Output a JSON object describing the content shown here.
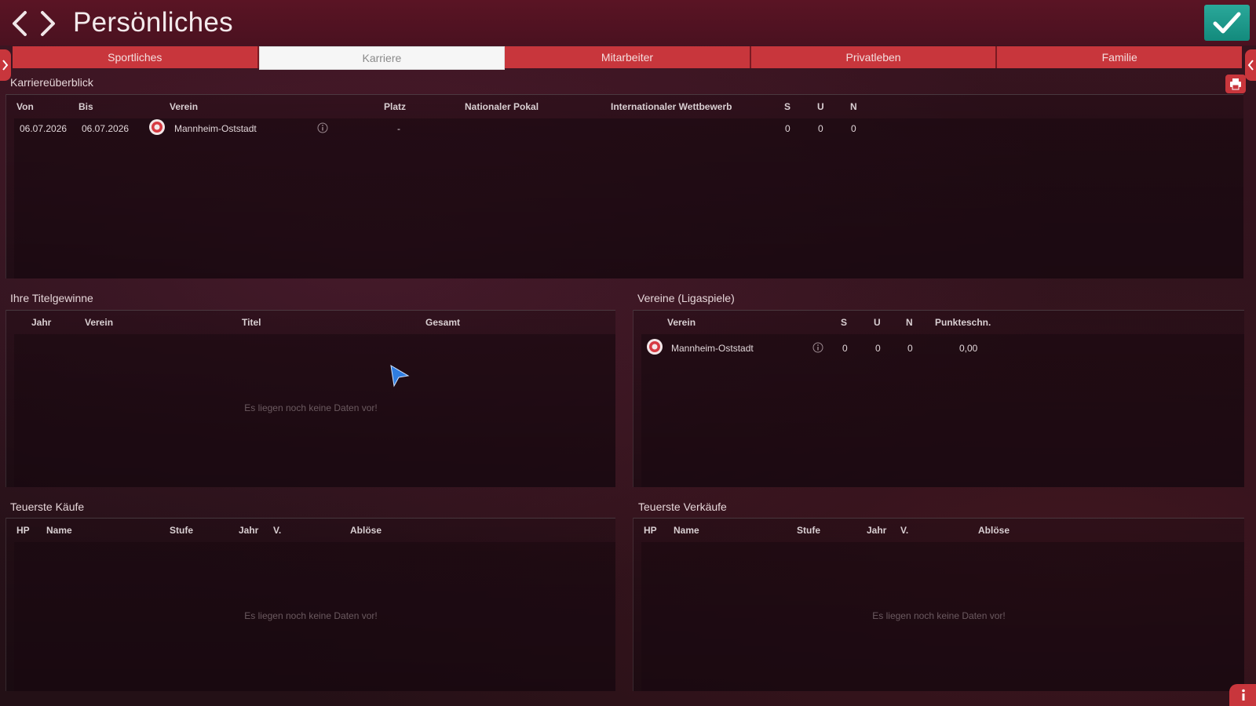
{
  "header": {
    "title": "Persönliches",
    "back_icon": "chevron-left-icon",
    "forward_icon": "chevron-right-icon",
    "confirm_icon": "checkmark-icon"
  },
  "tabs": [
    {
      "label": "Sportliches",
      "active": false
    },
    {
      "label": "Karriere",
      "active": true
    },
    {
      "label": "Mitarbeiter",
      "active": false
    },
    {
      "label": "Privatleben",
      "active": false
    },
    {
      "label": "Familie",
      "active": false
    }
  ],
  "career": {
    "title": "Karriereüberblick",
    "columns": {
      "von": "Von",
      "bis": "Bis",
      "verein": "Verein",
      "platz": "Platz",
      "pokal": "Nationaler Pokal",
      "intl": "Internationaler Wettbewerb",
      "s": "S",
      "u": "U",
      "n": "N"
    },
    "rows": [
      {
        "von": "06.07.2026",
        "bis": "06.07.2026",
        "verein": "Mannheim-Oststadt",
        "platz": "-",
        "pokal": "",
        "intl": "",
        "s": "0",
        "u": "0",
        "n": "0"
      }
    ]
  },
  "titles": {
    "title": "Ihre Titelgewinne",
    "columns": {
      "jahr": "Jahr",
      "verein": "Verein",
      "titel": "Titel",
      "gesamt": "Gesamt"
    },
    "empty": "Es liegen noch keine Daten vor!"
  },
  "clubs": {
    "title": "Vereine (Ligaspiele)",
    "columns": {
      "verein": "Verein",
      "s": "S",
      "u": "U",
      "n": "N",
      "punkte": "Punkteschn."
    },
    "rows": [
      {
        "verein": "Mannheim-Oststadt",
        "s": "0",
        "u": "0",
        "n": "0",
        "punkte": "0,00"
      }
    ]
  },
  "purchases": {
    "title": "Teuerste Käufe",
    "columns": {
      "hp": "HP",
      "name": "Name",
      "stufe": "Stufe",
      "jahr": "Jahr",
      "v": "V.",
      "abloese": "Ablöse"
    },
    "empty": "Es liegen noch keine Daten vor!"
  },
  "sales": {
    "title": "Teuerste Verkäufe",
    "columns": {
      "hp": "HP",
      "name": "Name",
      "stufe": "Stufe",
      "jahr": "Jahr",
      "v": "V.",
      "abloese": "Ablöse"
    },
    "empty": "Es liegen noch keine Daten vor!"
  },
  "colors": {
    "accent_red": "#c8363c",
    "confirm_teal": "#1a9a8a",
    "cursor_blue": "#2f7de0"
  }
}
